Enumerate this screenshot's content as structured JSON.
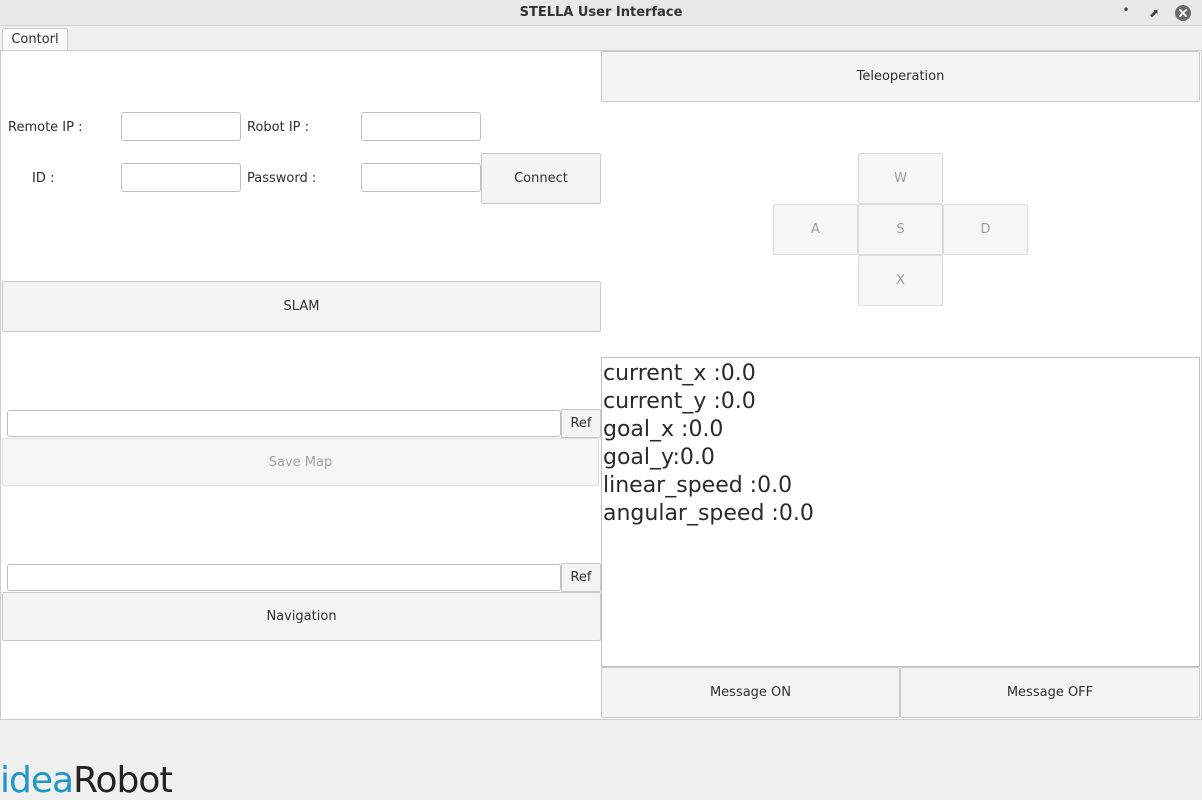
{
  "window": {
    "title": "STELLA User Interface",
    "minimize_glyph": "•",
    "maximize_glyph": "⬈",
    "close_glyph": "✕"
  },
  "tabs": [
    {
      "label": "Contorl"
    }
  ],
  "connection": {
    "remote_ip_label": "Remote IP :",
    "robot_ip_label": "Robot IP :",
    "id_label": "ID :",
    "password_label": "Password :",
    "remote_ip_value": "",
    "robot_ip_value": "",
    "id_value": "",
    "password_value": "",
    "connect_label": "Connect"
  },
  "slam": {
    "slam_label": "SLAM",
    "map_path_value": "",
    "ref_label": "Ref",
    "save_map_label": "Save Map"
  },
  "navigation": {
    "map_path_value": "",
    "ref_label": "Ref",
    "navigation_label": "Navigation"
  },
  "teleop": {
    "teleoperation_label": "Teleoperation",
    "keys": {
      "w": "W",
      "a": "A",
      "s": "S",
      "d": "D",
      "x": "X"
    }
  },
  "status": {
    "lines": [
      "current_x :0.0",
      "current_y :0.0",
      "goal_x :0.0",
      "goal_y:0.0",
      "linear_speed :0.0",
      "angular_speed :0.0"
    ]
  },
  "messages": {
    "on_label": "Message ON",
    "off_label": "Message OFF"
  },
  "logo": {
    "part1": "idea",
    "part2": "Robot",
    "colors": {
      "part1": "#1d96c8",
      "part2": "#222222"
    }
  }
}
